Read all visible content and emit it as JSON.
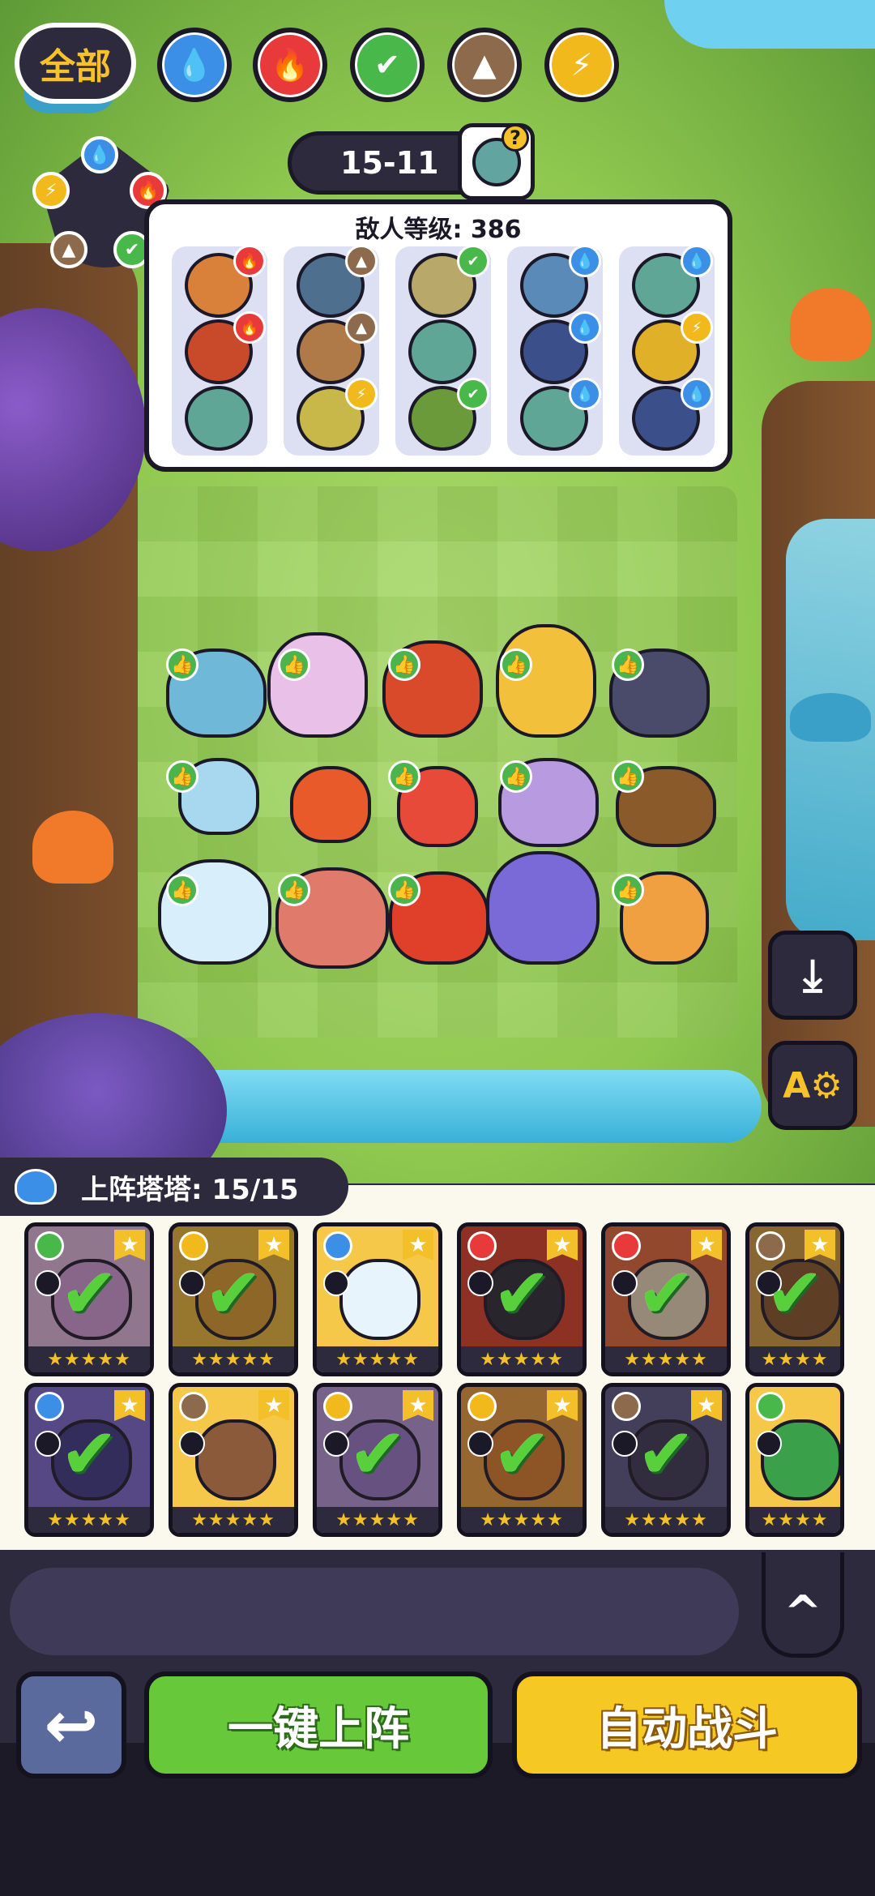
{
  "stage": {
    "label": "15-11",
    "help_icon": "question-mark-icon"
  },
  "enemy_panel": {
    "title": "敌人等级: 386"
  },
  "roster": {
    "label": "上阵塔塔: 15/15",
    "icon": "cat-icon"
  },
  "filters": {
    "all_label": "全部"
  },
  "actions": {
    "back_icon": "↩",
    "deploy_label": "一键上阵",
    "auto_label": "自动战斗",
    "collapse_icon": "^"
  },
  "side_buttons": {
    "save_icon": "download-icon",
    "auto_settings_icon": "auto-settings-icon",
    "save_glyph": "⤓",
    "auto_glyph": "A⚙"
  },
  "colors": {
    "fire": "#e83a3a",
    "water": "#3b8fe6",
    "leaf": "#49b84a",
    "earth": "#8d6a4b",
    "bolt": "#f2b91c",
    "deploy": "#67c93a",
    "auto": "#f6c824"
  }
}
